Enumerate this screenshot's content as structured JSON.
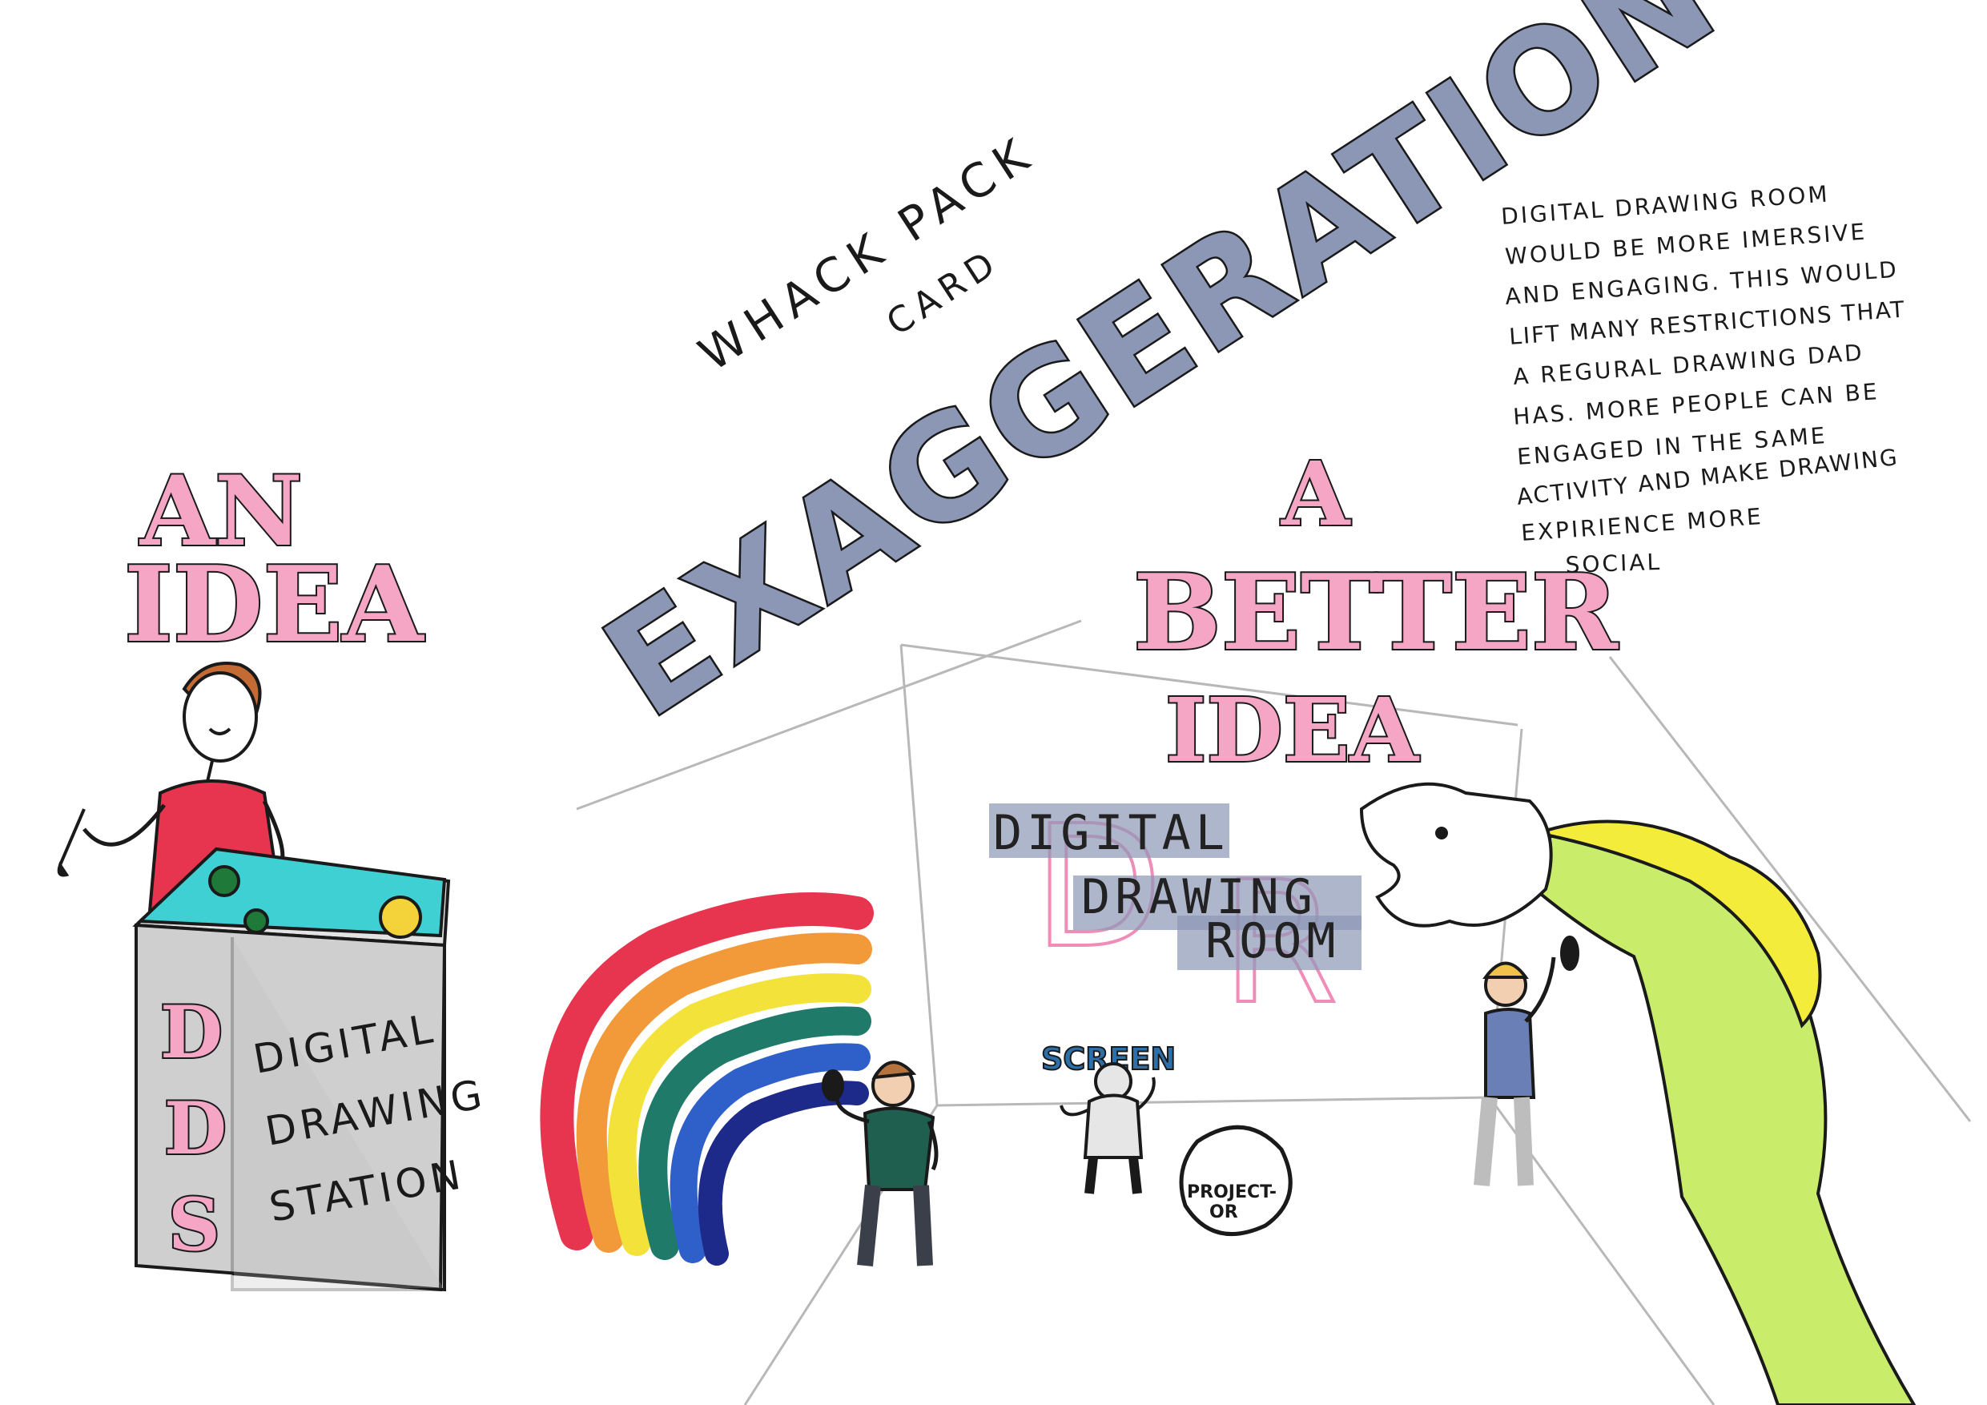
{
  "title": {
    "card_line1": "WHACK PACK",
    "card_line2": "CARD",
    "main": "EXAGGERATION"
  },
  "left": {
    "heading_line1": "AN",
    "heading_line2": "IDEA",
    "station_letters": [
      "D",
      "D",
      "S"
    ],
    "station_label": [
      "DIGITAL",
      "DRAWING",
      "STATION"
    ]
  },
  "right": {
    "heading_line1": "A",
    "heading_line2": "BETTER",
    "heading_line3": "IDEA",
    "room_label": [
      "DIGITAL",
      "DRAWING",
      "ROOM"
    ],
    "room_letters": [
      "D",
      "R"
    ],
    "screen_text": "SCREEN",
    "projector_line1": "PROJECT-",
    "projector_line2": "OR"
  },
  "description": [
    "DIGITAL DRAWING ROOM",
    "WOULD BE MORE IMERSIVE",
    "AND ENGAGING. THIS WOULD",
    "LIFT MANY RESTRICTIONS THAT",
    "A REGURAL DRAWING DAD",
    "HAS. MORE PEOPLE CAN BE",
    "ENGAGED IN THE SAME",
    "ACTIVITY AND MAKE DRAWING",
    "EXPIRIENCE MORE",
    "SOCIAL"
  ],
  "colors": {
    "pink": "#f4a6c4",
    "bubble": "#8c97b6",
    "shirt": "#e8354f",
    "screen": "#3fd0d4",
    "dragon_yellow": "#f3ec3a",
    "dragon_green": "#c9ec6a"
  }
}
